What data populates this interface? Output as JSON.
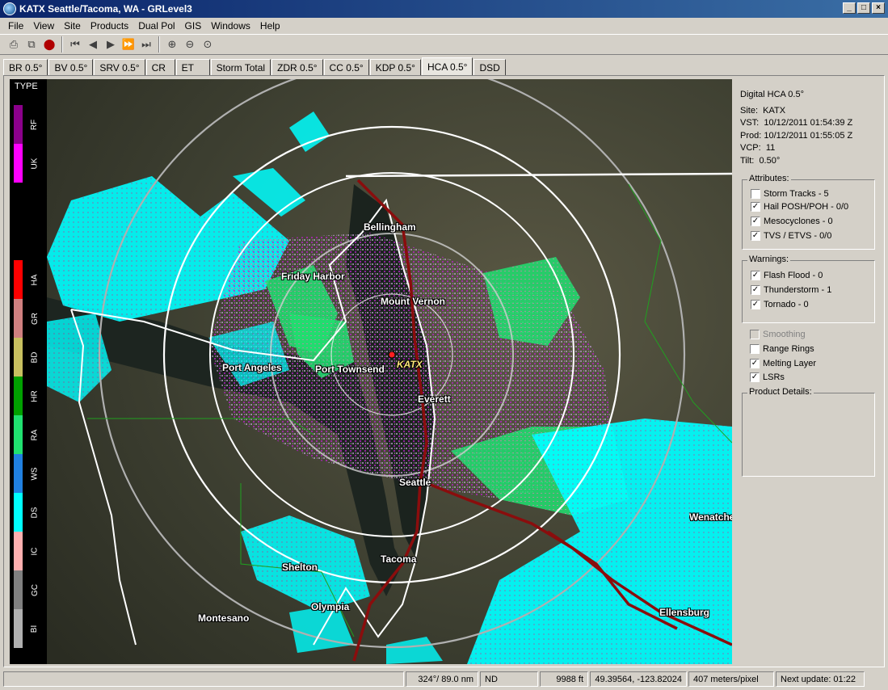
{
  "window": {
    "title": "KATX Seattle/Tacoma, WA - GRLevel3",
    "buttons": [
      "minimize",
      "maximize",
      "close"
    ]
  },
  "menu": [
    "File",
    "View",
    "Site",
    "Products",
    "Dual Pol",
    "GIS",
    "Windows",
    "Help"
  ],
  "toolbar": {
    "icons": [
      "print-icon",
      "copy-icon",
      "record-icon",
      "first-frame-icon",
      "step-back-icon",
      "play-icon",
      "step-forward-icon",
      "last-frame-icon",
      "zoom-in-icon",
      "zoom-out-icon",
      "zoom-reset-icon"
    ]
  },
  "tabs": [
    "BR 0.5°",
    "BV 0.5°",
    "SRV 0.5°",
    "CR",
    "ET",
    "Storm Total",
    "ZDR 0.5°",
    "CC 0.5°",
    "KDP 0.5°",
    "HCA 0.5°",
    "DSD"
  ],
  "active_tab": "HCA 0.5°",
  "legend": {
    "title": "TYPE",
    "classes": [
      {
        "code": "RF",
        "color": "#8b008b"
      },
      {
        "code": "UK",
        "color": "#ff00ff"
      },
      {
        "code": "",
        "color": "#000000"
      },
      {
        "code": "",
        "color": "#000000"
      },
      {
        "code": "HA",
        "color": "#ff0000"
      },
      {
        "code": "GR",
        "color": "#d08080"
      },
      {
        "code": "BD",
        "color": "#c8c060"
      },
      {
        "code": "HR",
        "color": "#00a000"
      },
      {
        "code": "RA",
        "color": "#20e070"
      },
      {
        "code": "WS",
        "color": "#2080e0"
      },
      {
        "code": "DS",
        "color": "#00ffff"
      },
      {
        "code": "IC",
        "color": "#ffb0b0"
      },
      {
        "code": "GC",
        "color": "#808080"
      },
      {
        "code": "BI",
        "color": "#b0b0b0"
      }
    ]
  },
  "map": {
    "site": "KATX",
    "cities": [
      "Bellingham",
      "Friday Harbor",
      "Mount Vernon",
      "Port Angeles",
      "Port Townsend",
      "Everett",
      "Seattle",
      "Tacoma",
      "Shelton",
      "Olympia",
      "Montesano",
      "Wenatchee",
      "Ellensburg"
    ]
  },
  "info": {
    "product": "Digital HCA 0.5°",
    "site_label": "Site:",
    "site": "KATX",
    "vst_label": "VST:",
    "vst": "10/12/2011  01:54:39 Z",
    "prod_label": "Prod:",
    "prod": "10/12/2011  01:55:05 Z",
    "vcp_label": "VCP:",
    "vcp": "11",
    "tilt_label": "Tilt:",
    "tilt": "0.50°"
  },
  "attributes": {
    "title": "Attributes:",
    "items": [
      {
        "label": "Storm Tracks - 5",
        "checked": false
      },
      {
        "label": "Hail POSH/POH - 0/0",
        "checked": true
      },
      {
        "label": "Mesocyclones - 0",
        "checked": true
      },
      {
        "label": "TVS / ETVS - 0/0",
        "checked": true
      }
    ]
  },
  "warnings": {
    "title": "Warnings:",
    "items": [
      {
        "label": "Flash Flood - 0",
        "checked": true
      },
      {
        "label": "Thunderstorm - 1",
        "checked": true
      },
      {
        "label": "Tornado - 0",
        "checked": true
      }
    ]
  },
  "options": [
    {
      "label": "Smoothing",
      "checked": false,
      "disabled": true
    },
    {
      "label": "Range Rings",
      "checked": false,
      "disabled": false
    },
    {
      "label": "Melting Layer",
      "checked": true,
      "disabled": false
    },
    {
      "label": "LSRs",
      "checked": true,
      "disabled": false
    }
  ],
  "product_details": {
    "title": "Product Details:"
  },
  "status": {
    "azimuth_range": "324°/ 89.0 nm",
    "value": "ND",
    "height": "9988 ft",
    "latlon": "49.39564, -123.82024",
    "scale": "407 meters/pixel",
    "next_update": "Next update: 01:22"
  }
}
